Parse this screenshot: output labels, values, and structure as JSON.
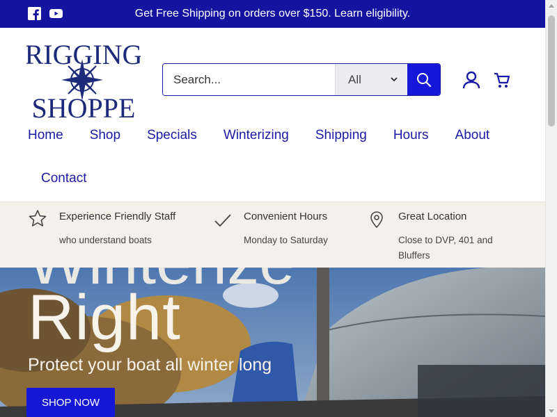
{
  "announcement": {
    "text": "Get Free Shipping on orders over $150. Learn eligibility.",
    "social": [
      "facebook-icon",
      "youtube-icon"
    ]
  },
  "logo": {
    "line1": "RIGGING",
    "line2": "SHOPPE"
  },
  "search": {
    "placeholder": "Search...",
    "category": "All"
  },
  "nav": {
    "items": [
      "Home",
      "Shop",
      "Specials",
      "Winterizing",
      "Shipping",
      "Hours",
      "About"
    ],
    "contact": "Contact"
  },
  "features": [
    {
      "icon": "star-icon",
      "title": "Experience Friendly Staff",
      "sub": "who understand boats"
    },
    {
      "icon": "checkmark-icon",
      "title": "Convenient Hours",
      "sub": "Monday to Saturday"
    },
    {
      "icon": "location-pin-icon",
      "title": "Great Location",
      "sub": "Close to DVP, 401 and Bluffers"
    }
  ],
  "hero": {
    "headline": "Right",
    "subtitle": "Protect your boat all winter long",
    "button": "SHOP NOW"
  },
  "colors": {
    "brand": "#1414a0",
    "accent": "#1717d9",
    "feature_bg": "#f4f1ea"
  }
}
